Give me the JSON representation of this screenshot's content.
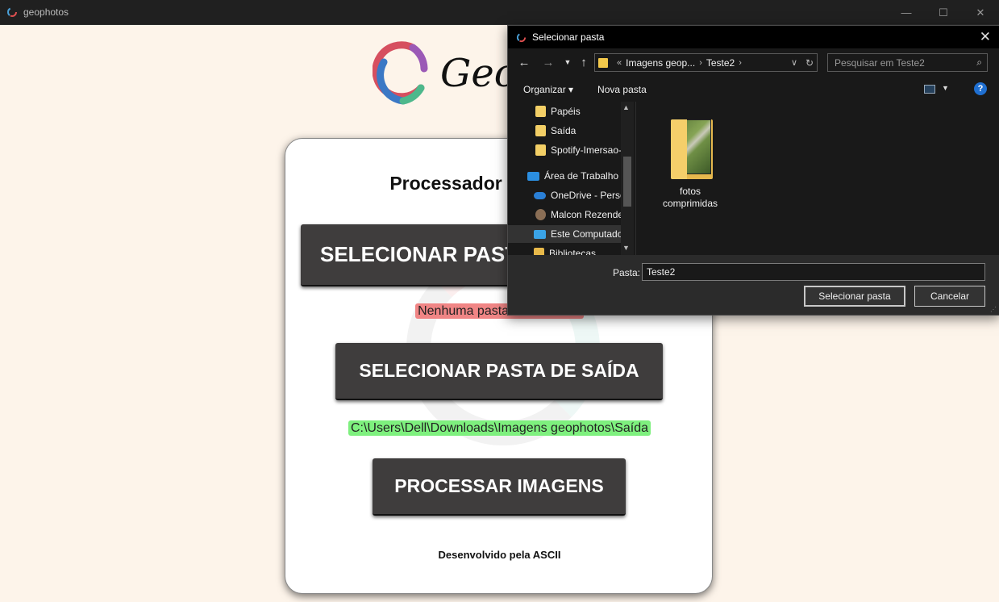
{
  "window": {
    "title": "geophotos",
    "controls": [
      "—",
      "☐",
      "✕"
    ]
  },
  "logo": {
    "text": "Geo"
  },
  "card": {
    "title": "Processador de Imagens",
    "input_button": "SELECIONAR PASTA DE ENTRADA",
    "input_status": "Nenhuma pasta selecionada",
    "output_button": "SELECIONAR PASTA DE SAÍDA",
    "output_status": "C:\\Users\\Dell\\Downloads\\Imagens geophotos\\Saída",
    "process_button": "PROCESSAR IMAGENS",
    "footer": "Desenvolvido pela ASCII"
  },
  "dialog": {
    "title": "Selecionar pasta",
    "close": "✕",
    "address": {
      "overflow": "«",
      "segments": [
        "Imagens geop...",
        "Teste2"
      ]
    },
    "search_placeholder": "Pesquisar em Teste2",
    "toolbar": {
      "organize": "Organizar",
      "new_folder": "Nova pasta",
      "help": "?"
    },
    "nav_items": [
      {
        "label": "Papéis",
        "icon": "folder-icon"
      },
      {
        "label": "Saída",
        "icon": "folder-icon"
      },
      {
        "label": "Spotify-Imersao-",
        "icon": "folder-icon"
      },
      {
        "label": "Área de Trabalho",
        "icon": "desktop-icon"
      },
      {
        "label": "OneDrive - Perso",
        "icon": "onedrive-icon"
      },
      {
        "label": "Malcon Rezende",
        "icon": "user-icon"
      },
      {
        "label": "Este Computado",
        "icon": "computer-icon"
      },
      {
        "label": "Bibliotecas",
        "icon": "library-icon"
      }
    ],
    "files": [
      {
        "label": "fotos comprimidas",
        "icon": "folder-icon"
      }
    ],
    "pasta_label": "Pasta:",
    "pasta_value": "Teste2",
    "select_button": "Selecionar pasta",
    "cancel_button": "Cancelar"
  },
  "colors": {
    "background": "#fdf4ea",
    "button": "#3f3d3d",
    "status_error": "#f08585",
    "status_ok": "#7ef07e",
    "dialog_bg": "#191919"
  }
}
